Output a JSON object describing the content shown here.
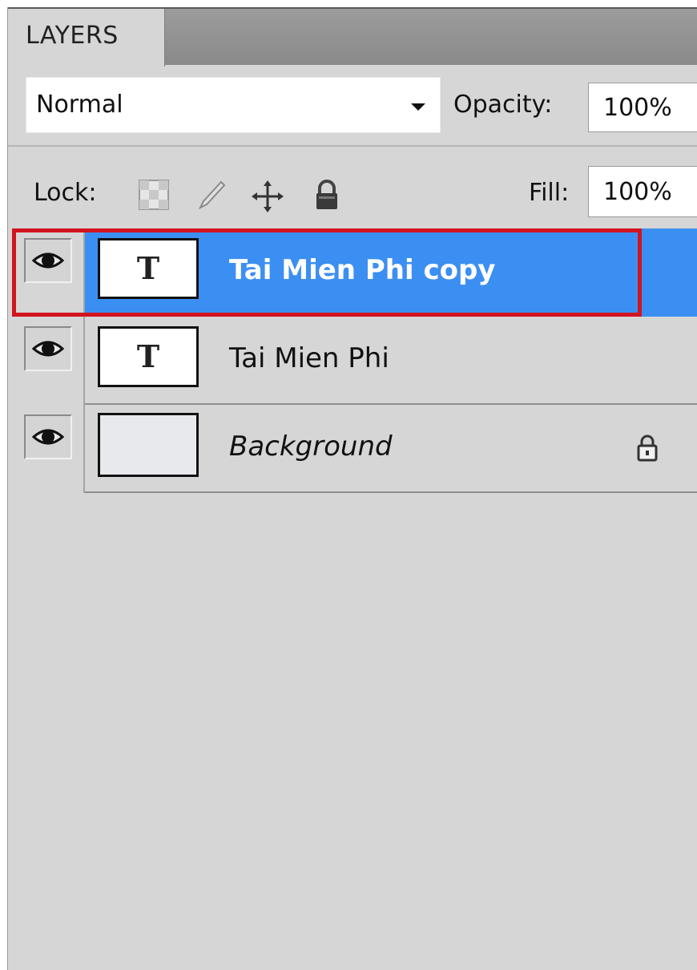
{
  "panel": {
    "tab_label": "LAYERS"
  },
  "blend": {
    "mode": "Normal",
    "opacity_label": "Opacity:",
    "opacity_value": "100%"
  },
  "lock": {
    "label": "Lock:",
    "fill_label": "Fill:",
    "fill_value": "100%",
    "icons": [
      "lock-transparent-pixels-icon",
      "lock-image-pixels-icon",
      "lock-position-icon",
      "lock-all-icon"
    ]
  },
  "layers": [
    {
      "name": "Tai Mien Phi copy",
      "type": "text",
      "thumb_glyph": "T",
      "selected": true,
      "visible": true
    },
    {
      "name": "Tai Mien Phi",
      "type": "text",
      "thumb_glyph": "T",
      "selected": false,
      "visible": true
    },
    {
      "name": "Background",
      "type": "background",
      "locked": true,
      "selected": false,
      "visible": true
    }
  ],
  "colors": {
    "selection": "#3c8ff2",
    "highlight_box": "#d1141f",
    "panel_bg": "#d6d6d6"
  }
}
